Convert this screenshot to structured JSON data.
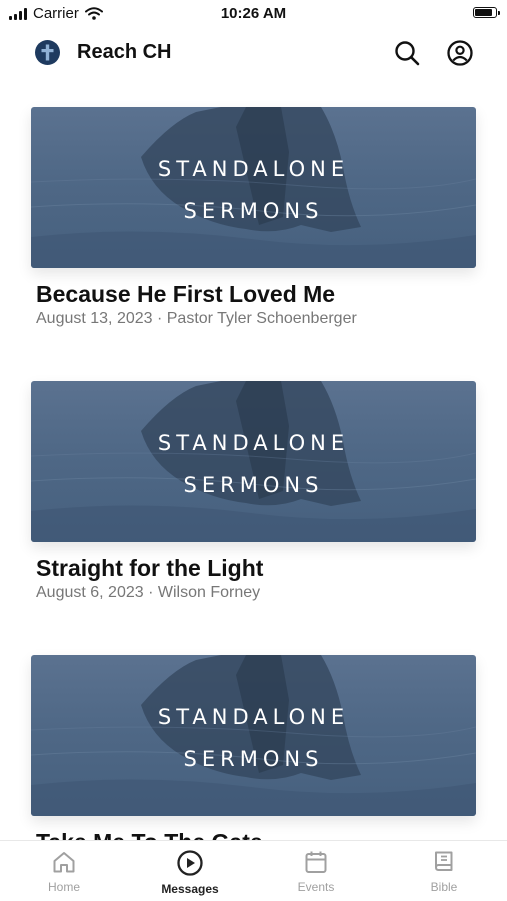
{
  "status_bar": {
    "carrier": "Carrier",
    "time": "10:26 AM",
    "battery_level": 0.9
  },
  "header": {
    "title": "Reach CH",
    "logo_icon": "cross-logo-icon",
    "search_icon": "search-icon",
    "account_icon": "account-icon"
  },
  "messages": [
    {
      "thumb_line1": "STANDALONE",
      "thumb_line2": "SERMONS",
      "title": "Because He First Loved Me",
      "meta": "August 13, 2023 · Pastor Tyler Schoenberger"
    },
    {
      "thumb_line1": "STANDALONE",
      "thumb_line2": "SERMONS",
      "title": "Straight for the Light",
      "meta": "August 6, 2023 · Wilson Forney"
    },
    {
      "thumb_line1": "STANDALONE",
      "thumb_line2": "SERMONS",
      "title": "Take Me To The Gate",
      "meta": ""
    }
  ],
  "tabs": [
    {
      "label": "Home",
      "icon": "home-icon",
      "active": false
    },
    {
      "label": "Messages",
      "icon": "play-circle-icon",
      "active": true
    },
    {
      "label": "Events",
      "icon": "calendar-icon",
      "active": false
    },
    {
      "label": "Bible",
      "icon": "book-icon",
      "active": false
    }
  ],
  "colors": {
    "accent": "#1e3a5f",
    "thumb": "#4f6886",
    "inactive_tab": "#a0a0a0",
    "meta_text": "#777777"
  }
}
